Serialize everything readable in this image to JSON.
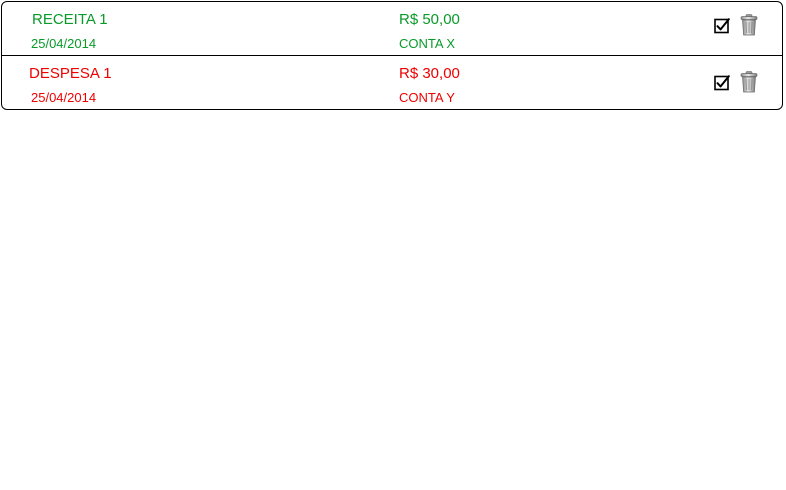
{
  "colors": {
    "income": "#0a9a2a",
    "expense": "#ee0000"
  },
  "entries": [
    {
      "type": "income",
      "title": "RECEITA 1",
      "date": "25/04/2014",
      "amount": "R$ 50,00",
      "account": "CONTA X",
      "confirmed": true,
      "check_icon": "checked-box-icon",
      "delete_icon": "trash-can-icon"
    },
    {
      "type": "expense",
      "title": "DESPESA 1",
      "date": "25/04/2014",
      "amount": "R$ 30,00",
      "account": "CONTA Y",
      "confirmed": true,
      "check_icon": "checked-box-icon",
      "delete_icon": "trash-can-icon"
    }
  ]
}
